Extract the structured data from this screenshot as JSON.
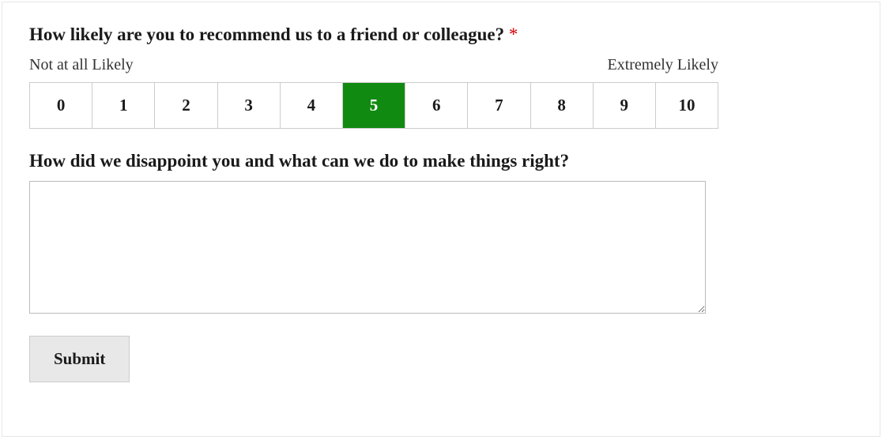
{
  "question": {
    "label": "How likely are you to recommend us to a friend or colleague?",
    "required_marker": "*",
    "scale_low_label": "Not at all Likely",
    "scale_high_label": "Extremely Likely",
    "options": [
      "0",
      "1",
      "2",
      "3",
      "4",
      "5",
      "6",
      "7",
      "8",
      "9",
      "10"
    ],
    "selected_index": 5
  },
  "followup": {
    "label": "How did we disappoint you and what can we do to make things right?",
    "value": ""
  },
  "submit": {
    "label": "Submit"
  }
}
